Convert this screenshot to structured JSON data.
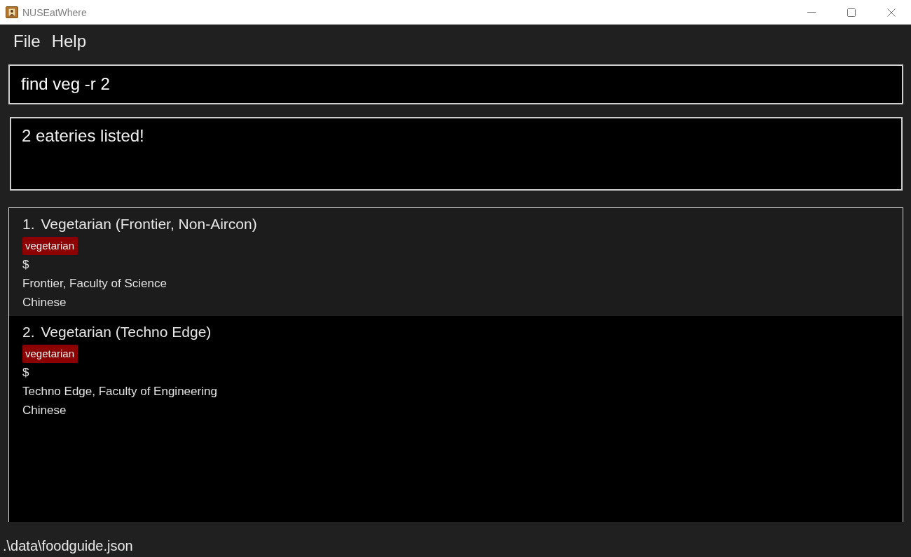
{
  "window": {
    "title": "NUSEatWhere"
  },
  "menu_bar": {
    "items": [
      "File",
      "Help"
    ]
  },
  "command_box": {
    "value": "find veg -r 2"
  },
  "result_display": {
    "text": "2 eateries listed!"
  },
  "eatery_list": {
    "items": [
      {
        "index": "1.",
        "name": "Vegetarian (Frontier, Non-Aircon)",
        "tags": [
          "vegetarian"
        ],
        "price": "$",
        "location": "Frontier, Faculty of Science",
        "cuisine": "Chinese"
      },
      {
        "index": "2.",
        "name": "Vegetarian (Techno Edge)",
        "tags": [
          "vegetarian"
        ],
        "price": "$",
        "location": "Techno Edge, Faculty of Engineering",
        "cuisine": "Chinese"
      }
    ]
  },
  "status_bar": {
    "path": ".\\data\\foodguide.json"
  }
}
